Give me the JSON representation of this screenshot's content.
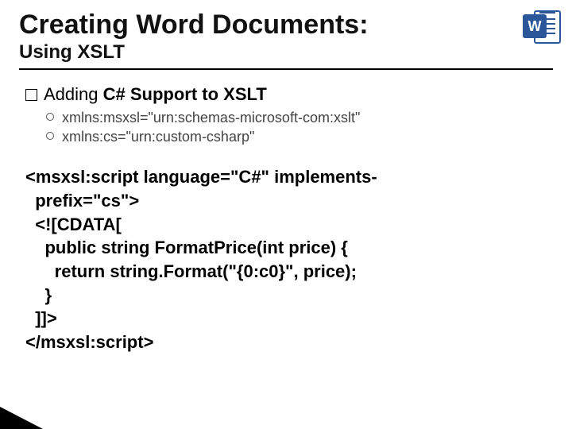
{
  "title": "Creating Word Documents:",
  "subtitle": "Using XSLT",
  "icon_letter": "W",
  "bullet_l1": {
    "lead": "Adding",
    "rest": " C# Support to XSLT"
  },
  "bullets_l2": [
    "xmlns:msxsl=\"urn:schemas-microsoft-com:xslt\"",
    "xmlns:cs=\"urn:custom-csharp\""
  ],
  "code_lines": [
    "<msxsl:script language=\"C#\" implements-",
    "  prefix=\"cs\">",
    "  <![CDATA[",
    "    public string FormatPrice(int price) {",
    "      return string.Format(\"{0:c0}\", price);",
    "    }",
    "  ]]>",
    "</msxsl:script>"
  ]
}
